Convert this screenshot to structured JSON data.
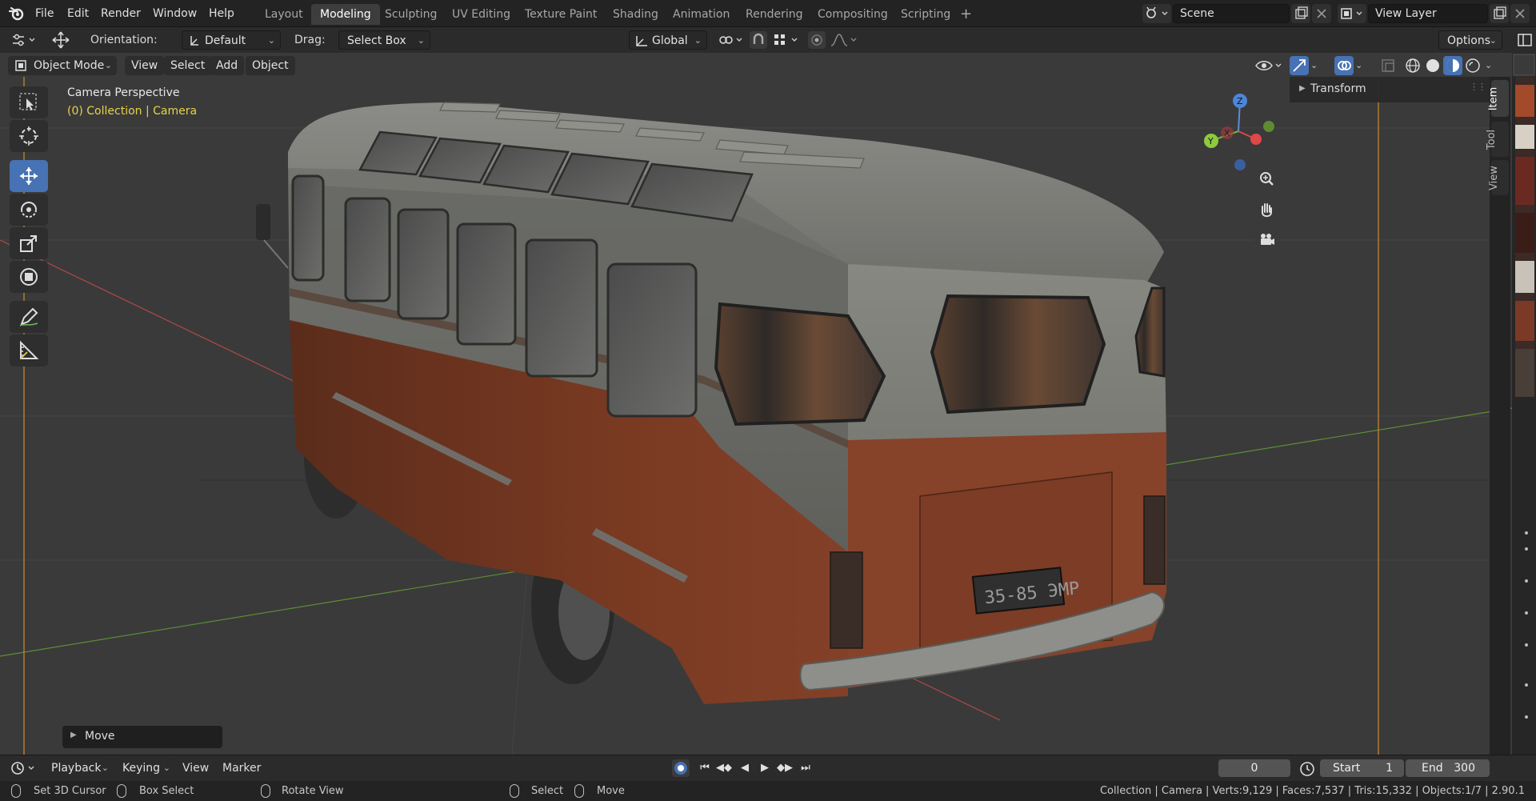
{
  "topbar": {
    "menus": [
      "File",
      "Edit",
      "Render",
      "Window",
      "Help"
    ],
    "workspaces": [
      "Layout",
      "Modeling",
      "Sculpting",
      "UV Editing",
      "Texture Paint",
      "Shading",
      "Animation",
      "Rendering",
      "Compositing",
      "Scripting"
    ],
    "active_workspace": "Modeling",
    "scene_name": "Scene",
    "view_layer": "View Layer"
  },
  "toolheader": {
    "orientation_label": "Orientation:",
    "orientation_value": "Default",
    "drag_label": "Drag:",
    "drag_value": "Select Box",
    "transform_orientation": "Global",
    "options_label": "Options"
  },
  "viewport_header": {
    "mode": "Object Mode",
    "menus": [
      "View",
      "Select",
      "Add",
      "Object"
    ]
  },
  "viewport": {
    "perspective_label": "Camera Perspective",
    "collection_label": "(0) Collection | Camera",
    "license_plate": "35-85 ЭМР",
    "gizmo_axes": [
      "Z",
      "X",
      "Y"
    ],
    "last_op_label": "Move"
  },
  "npanel": {
    "section": "Transform",
    "tabs": [
      "Item",
      "Tool",
      "View"
    ],
    "active_tab": "Item"
  },
  "timeline": {
    "menus": [
      "Playback",
      "Keying",
      "View",
      "Marker"
    ],
    "current_frame": "0",
    "start_label": "Start",
    "start_value": "1",
    "end_label": "End",
    "end_value": "300"
  },
  "statusbar": {
    "hints": [
      "Set 3D Cursor",
      "Box Select",
      "Rotate View",
      "Select",
      "Move"
    ],
    "stats": "Collection | Camera | Verts:9,129 | Faces:7,537 | Tris:15,332 | Objects:1/7 | 2.90.1"
  },
  "colors": {
    "accent": "#4772b3",
    "collection_text": "#e6d24c",
    "bus_roof": "#7a7b76",
    "bus_body": "#7d3a23",
    "axis_x": "#c04a4a",
    "axis_y": "#6a9a3a"
  }
}
